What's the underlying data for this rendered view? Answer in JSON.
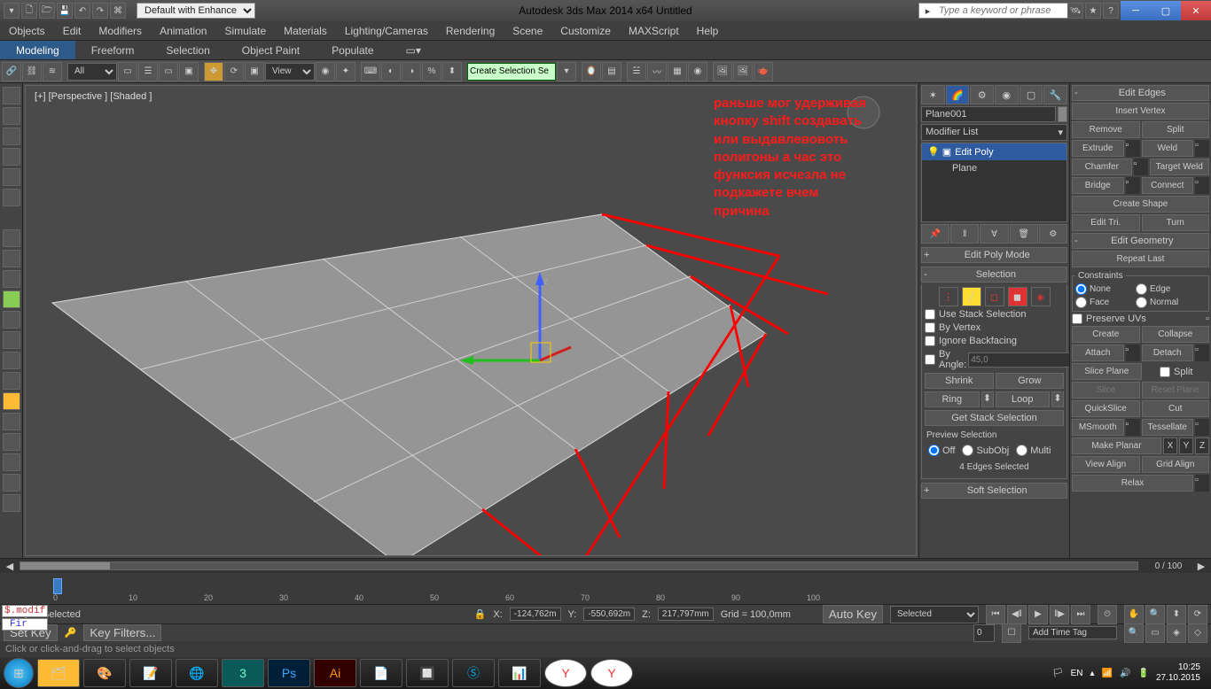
{
  "title": "Autodesk 3ds Max  2014 x64     Untitled",
  "default_dropdown": "Default with Enhance",
  "search_placeholder": "Type a keyword or phrase",
  "menus": [
    "Objects",
    "Edit",
    "Modifiers",
    "Animation",
    "Simulate",
    "Materials",
    "Lighting/Cameras",
    "Rendering",
    "Scene",
    "Customize",
    "MAXScript",
    "Help"
  ],
  "ribbon": [
    "Modeling",
    "Freeform",
    "Selection",
    "Object Paint",
    "Populate"
  ],
  "toolbar_all": "All",
  "toolbar_view": "View",
  "toolbar_sel": "Create Selection Se",
  "viewport_label": "[+] [Perspective ] [Shaded ]",
  "annotation": "раньше мог удерживая\nкнопку shift создавать\nили выдавлевовоть\nполигоны а час это\nфунксия исчезла не\nподкажете вчем\nпричина",
  "object_name": "Plane001",
  "modifier_list": "Modifier List",
  "stack": [
    {
      "label": "Edit Poly",
      "active": true,
      "icons": true
    },
    {
      "label": "Plane",
      "active": false,
      "icons": false
    }
  ],
  "rollouts": {
    "edit_poly_mode": "Edit Poly Mode",
    "selection": "Selection",
    "use_stack": "Use Stack Selection",
    "by_vertex": "By Vertex",
    "ignore_backfacing": "Ignore Backfacing",
    "by_angle": "By Angle:",
    "angle_val": "45,0",
    "shrink": "Shrink",
    "grow": "Grow",
    "ring": "Ring",
    "loop": "Loop",
    "get_stack": "Get Stack Selection",
    "preview": "Preview Selection",
    "off": "Off",
    "subobj": "SubObj",
    "multi": "Multi",
    "edges_sel": "4 Edges Selected",
    "soft_sel": "Soft Selection"
  },
  "right": {
    "edit_edges": "Edit Edges",
    "insert_vertex": "Insert Vertex",
    "remove": "Remove",
    "split": "Split",
    "extrude": "Extrude",
    "weld": "Weld",
    "chamfer": "Chamfer",
    "target_weld": "Target Weld",
    "bridge": "Bridge",
    "connect": "Connect",
    "create_shape": "Create Shape",
    "edit_tri": "Edit Tri.",
    "turn": "Turn",
    "edit_geom": "Edit Geometry",
    "repeat": "Repeat Last",
    "constraints": "Constraints",
    "none": "None",
    "edge": "Edge",
    "face": "Face",
    "normal": "Normal",
    "preserve_uvs": "Preserve UVs",
    "create": "Create",
    "collapse": "Collapse",
    "attach": "Attach",
    "detach": "Detach",
    "slice_plane": "Slice Plane",
    "split2": "Split",
    "slice": "Slice",
    "reset_plane": "Reset Plane",
    "quickslice": "QuickSlice",
    "cut": "Cut",
    "msmooth": "MSmooth",
    "tessellate": "Tessellate",
    "make_planar": "Make Planar",
    "view_align": "View Align",
    "grid_align": "Grid Align",
    "relax": "Relax"
  },
  "timeline": {
    "pos": "0 / 100",
    "ticks": [
      0,
      10,
      20,
      30,
      40,
      50,
      60,
      70,
      80,
      90,
      100
    ]
  },
  "status": {
    "objsel": "1 Object Selected",
    "x": "-124,762m",
    "y": "-550,692m",
    "z": "217,797mm",
    "grid": "Grid = 100,0mm",
    "autokey": "Auto Key",
    "setkey": "Set Key",
    "selected": "Selected",
    "keyfilters": "Key Filters...",
    "addtimetag": "Add Time Tag"
  },
  "prompt": "Click or click-and-drag to select objects",
  "modif": [
    "$.modif",
    "Fir"
  ],
  "tray": {
    "lang": "EN",
    "time": "10:25",
    "date": "27.10.2015"
  }
}
